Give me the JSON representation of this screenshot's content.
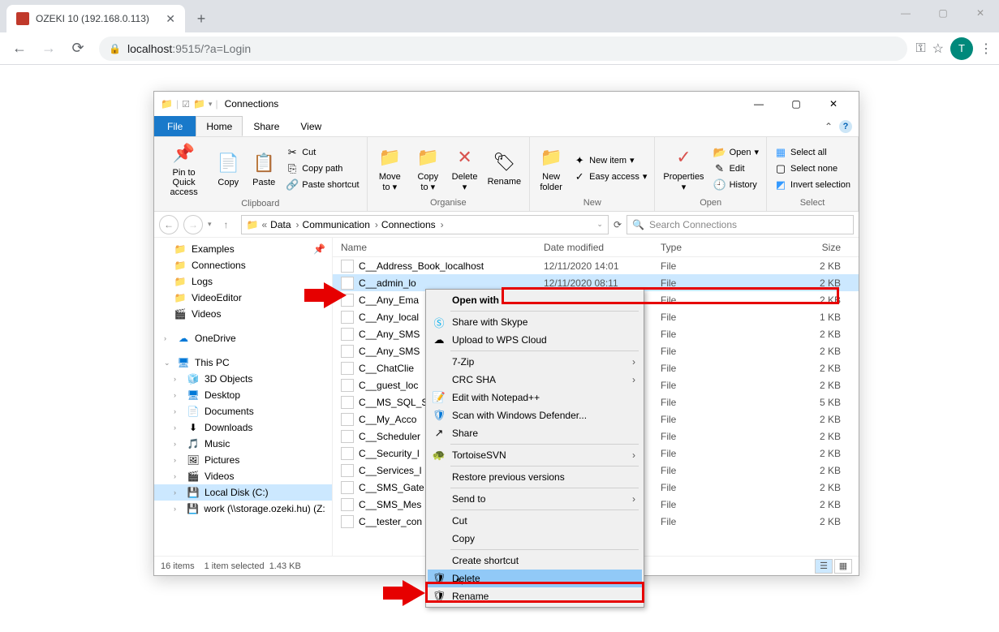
{
  "browser": {
    "tab_title": "OZEKI 10 (192.168.0.113)",
    "url_host": "localhost",
    "url_path": ":9515/?a=Login",
    "avatar_letter": "T"
  },
  "explorer": {
    "title": "Connections",
    "menu": {
      "file": "File",
      "home": "Home",
      "share": "Share",
      "view": "View"
    },
    "ribbon": {
      "pin": "Pin to Quick access",
      "copy": "Copy",
      "paste": "Paste",
      "cut": "Cut",
      "copy_path": "Copy path",
      "paste_shortcut": "Paste shortcut",
      "moveto": "Move to",
      "copyto": "Copy to",
      "delete": "Delete",
      "rename": "Rename",
      "newfolder": "New folder",
      "newitem": "New item",
      "easyaccess": "Easy access",
      "properties": "Properties",
      "open": "Open",
      "edit": "Edit",
      "history": "History",
      "selectall": "Select all",
      "selectnone": "Select none",
      "invert": "Invert selection",
      "g_clipboard": "Clipboard",
      "g_organise": "Organise",
      "g_new": "New",
      "g_open": "Open",
      "g_select": "Select"
    },
    "breadcrumb": [
      "Data",
      "Communication",
      "Connections"
    ],
    "search_placeholder": "Search Connections",
    "columns": {
      "name": "Name",
      "date": "Date modified",
      "type": "Type",
      "size": "Size"
    },
    "nav": {
      "examples": "Examples",
      "connections": "Connections",
      "logs": "Logs",
      "videoeditor": "VideoEditor",
      "videos": "Videos",
      "onedrive": "OneDrive",
      "thispc": "This PC",
      "obj3d": "3D Objects",
      "desktop": "Desktop",
      "documents": "Documents",
      "downloads": "Downloads",
      "music": "Music",
      "pictures": "Pictures",
      "videos2": "Videos",
      "localdisk": "Local Disk (C:)",
      "work": "work (\\\\storage.ozeki.hu) (Z:)"
    },
    "files": [
      {
        "n": "C__Address_Book_localhost",
        "d": "12/11/2020 14:01",
        "t": "File",
        "s": "2 KB"
      },
      {
        "n": "C__admin_lo",
        "d": "12/11/2020 08:11",
        "t": "File",
        "s": "2 KB"
      },
      {
        "n": "C__Any_Ema",
        "d": "",
        "t": "File",
        "s": "2 KB"
      },
      {
        "n": "C__Any_local",
        "d": "",
        "t": "File",
        "s": "1 KB"
      },
      {
        "n": "C__Any_SMS",
        "d": "",
        "t": "File",
        "s": "2 KB"
      },
      {
        "n": "C__Any_SMS",
        "d": "",
        "t": "File",
        "s": "2 KB"
      },
      {
        "n": "C__ChatClie",
        "d": "",
        "t": "File",
        "s": "2 KB"
      },
      {
        "n": "C__guest_loc",
        "d": "",
        "t": "File",
        "s": "2 KB"
      },
      {
        "n": "C__MS_SQL_S",
        "d": "",
        "t": "File",
        "s": "5 KB"
      },
      {
        "n": "C__My_Acco",
        "d": "",
        "t": "File",
        "s": "2 KB"
      },
      {
        "n": "C__Scheduler",
        "d": "",
        "t": "File",
        "s": "2 KB"
      },
      {
        "n": "C__Security_l",
        "d": "",
        "t": "File",
        "s": "2 KB"
      },
      {
        "n": "C__Services_l",
        "d": "",
        "t": "File",
        "s": "2 KB"
      },
      {
        "n": "C__SMS_Gate",
        "d": "",
        "t": "File",
        "s": "2 KB"
      },
      {
        "n": "C__SMS_Mes",
        "d": "",
        "t": "File",
        "s": "2 KB"
      },
      {
        "n": "C__tester_con",
        "d": "",
        "t": "File",
        "s": "2 KB"
      }
    ],
    "status": {
      "count": "16 items",
      "sel": "1 item selected",
      "size": "1.43 KB"
    }
  },
  "context_menu": {
    "open_with": "Open with",
    "skype": "Share with Skype",
    "wps": "Upload to WPS Cloud",
    "zip": "7-Zip",
    "crc": "CRC SHA",
    "notepad": "Edit with Notepad++",
    "defender": "Scan with Windows Defender...",
    "share": "Share",
    "svn": "TortoiseSVN",
    "restore": "Restore previous versions",
    "sendto": "Send to",
    "cut": "Cut",
    "copy": "Copy",
    "shortcut": "Create shortcut",
    "delete": "Delete",
    "rename": "Rename"
  }
}
